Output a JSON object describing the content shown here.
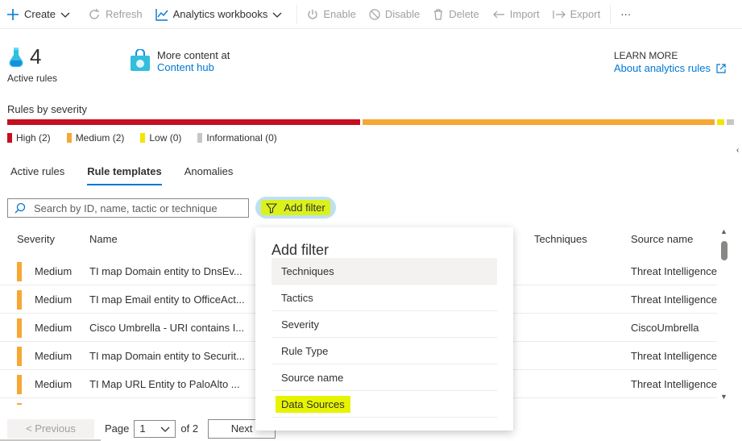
{
  "toolbar": {
    "create": "Create",
    "refresh": "Refresh",
    "workbooks": "Analytics workbooks",
    "enable": "Enable",
    "disable": "Disable",
    "delete": "Delete",
    "import": "Import",
    "export": "Export",
    "more": "···"
  },
  "stats": {
    "count": "4",
    "label": "Active rules"
  },
  "hub": {
    "line1": "More content at",
    "link": "Content hub"
  },
  "learn": {
    "title": "LEARN MORE",
    "link": "About analytics rules"
  },
  "severity": {
    "title": "Rules by severity",
    "legend": [
      {
        "label": "High (2)",
        "color": "#c50f1f"
      },
      {
        "label": "Medium (2)",
        "color": "#f7a735"
      },
      {
        "label": "Low (0)",
        "color": "#f2e600"
      },
      {
        "label": "Informational (0)",
        "color": "#c8c6c4"
      }
    ]
  },
  "tabs": [
    {
      "label": "Active rules",
      "active": false
    },
    {
      "label": "Rule templates",
      "active": true
    },
    {
      "label": "Anomalies",
      "active": false
    }
  ],
  "search": {
    "placeholder": "Search by ID, name, tactic or technique"
  },
  "add_filter": "Add filter",
  "table": {
    "headers": {
      "severity": "Severity",
      "name": "Name",
      "techniques": "Techniques",
      "source": "Source name"
    },
    "rows": [
      {
        "severity": "Medium",
        "name": "TI map Domain entity to DnsEv...",
        "source": "Threat Intelligence"
      },
      {
        "severity": "Medium",
        "name": "TI map Email entity to OfficeAct...",
        "source": "Threat Intelligence"
      },
      {
        "severity": "Medium",
        "name": "Cisco Umbrella - URI contains I...",
        "source": "CiscoUmbrella"
      },
      {
        "severity": "Medium",
        "name": "TI map Domain entity to Securit...",
        "source": "Threat Intelligence"
      },
      {
        "severity": "Medium",
        "name": "TI Map URL Entity to PaloAlto ...",
        "source": "Threat Intelligence"
      }
    ]
  },
  "pager": {
    "prev": "< Previous",
    "page": "Page",
    "current": "1",
    "of": "of 2",
    "next": "Next"
  },
  "popup": {
    "title": "Add filter",
    "items": [
      "Techniques",
      "Tactics",
      "Severity",
      "Rule Type",
      "Source name",
      "Data Sources"
    ]
  },
  "colors": {
    "accent": "#0078d4",
    "highlight": "#e6f400"
  }
}
